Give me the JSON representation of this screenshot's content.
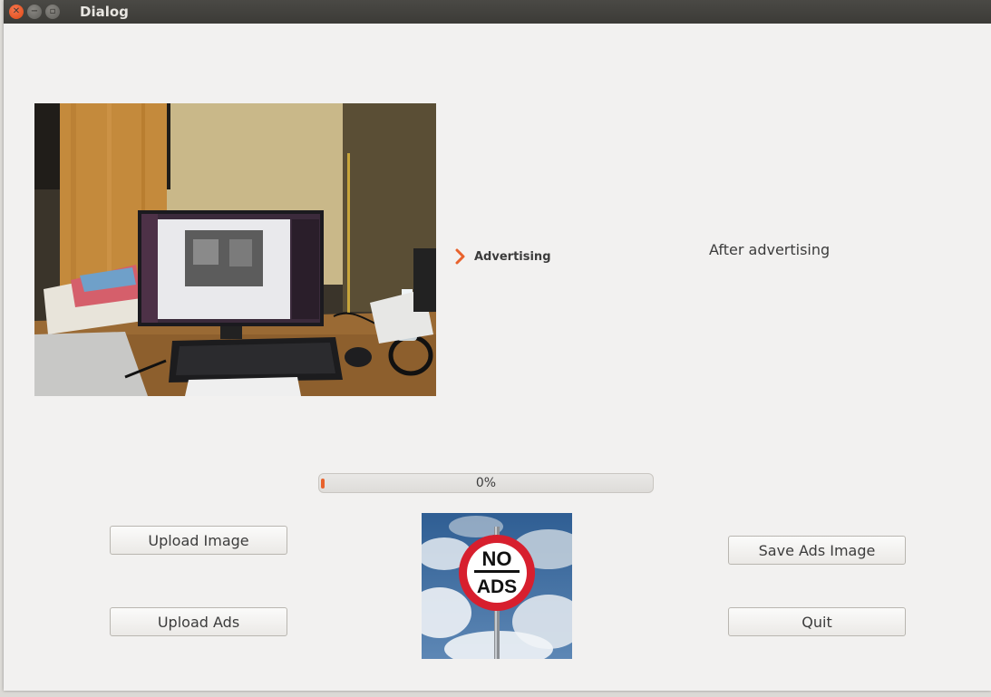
{
  "window": {
    "title": "Dialog"
  },
  "labels": {
    "advertising": "Advertising",
    "after_advertising": "After advertising"
  },
  "progress": {
    "value_percent": 0,
    "text": "0%",
    "accent_color": "#e8622c"
  },
  "buttons": {
    "upload_image": "Upload Image",
    "upload_ads": "Upload Ads",
    "save_ads_image": "Save Ads Image",
    "quit": "Quit"
  },
  "ads_sign": {
    "line1": "NO",
    "line2": "ADS"
  },
  "icons": {
    "close": "close-icon",
    "minimize": "minimize-icon",
    "maximize": "maximize-icon",
    "arrow": "chevron-right-icon"
  }
}
